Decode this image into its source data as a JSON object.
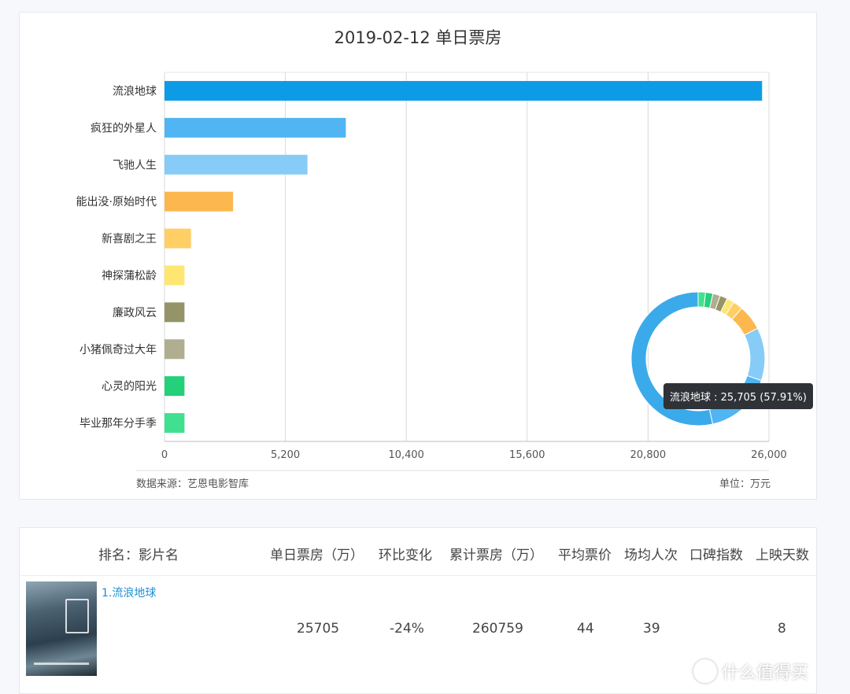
{
  "chart_data": {
    "type": "bar",
    "title": "2019-02-12 单日票房",
    "categories": [
      "流浪地球",
      "疯狂的外星人",
      "飞驰人生",
      "能出没·原始时代",
      "新喜剧之王",
      "神探蒲松龄",
      "廉政风云",
      "小猪佩奇过大年",
      "心灵的阳光",
      "毕业那年分手季"
    ],
    "values": [
      25705,
      7800,
      6150,
      2950,
      1140,
      860,
      860,
      860,
      860,
      860
    ],
    "colors": [
      "#0e9be6",
      "#50b5f2",
      "#86ccf7",
      "#fcb84f",
      "#ffcf66",
      "#ffe670",
      "#949468",
      "#b0ae90",
      "#24d07a",
      "#40e090"
    ],
    "xlim": [
      0,
      26000
    ],
    "xticks": [
      "0",
      "5,200",
      "10,400",
      "15,600",
      "20,800",
      "26,000"
    ],
    "grid": "vertical",
    "source": "数据来源：艺恩电影智库",
    "unit": "单位：万元",
    "donut": {
      "values": [
        25705,
        7800,
        6150,
        2950,
        1140,
        860,
        860,
        860,
        860,
        860
      ],
      "highlight_color": "#3aaaeb",
      "tooltip": "流浪地球 : 25,705 (57.91%)"
    }
  },
  "table": {
    "headers": [
      "排名：影片名",
      "单日票房（万）",
      "环比变化",
      "累计票房（万）",
      "平均票价",
      "场均人次",
      "口碑指数",
      "上映天数"
    ],
    "rows": [
      {
        "name": "1.流浪地球",
        "daily": "25705",
        "change": "-24%",
        "total": "260759",
        "price": "44",
        "per_show": "39",
        "rating": "",
        "days": "8"
      }
    ]
  },
  "watermark": {
    "text": "什么值得买",
    "icon": "smzdm-logo-icon"
  }
}
